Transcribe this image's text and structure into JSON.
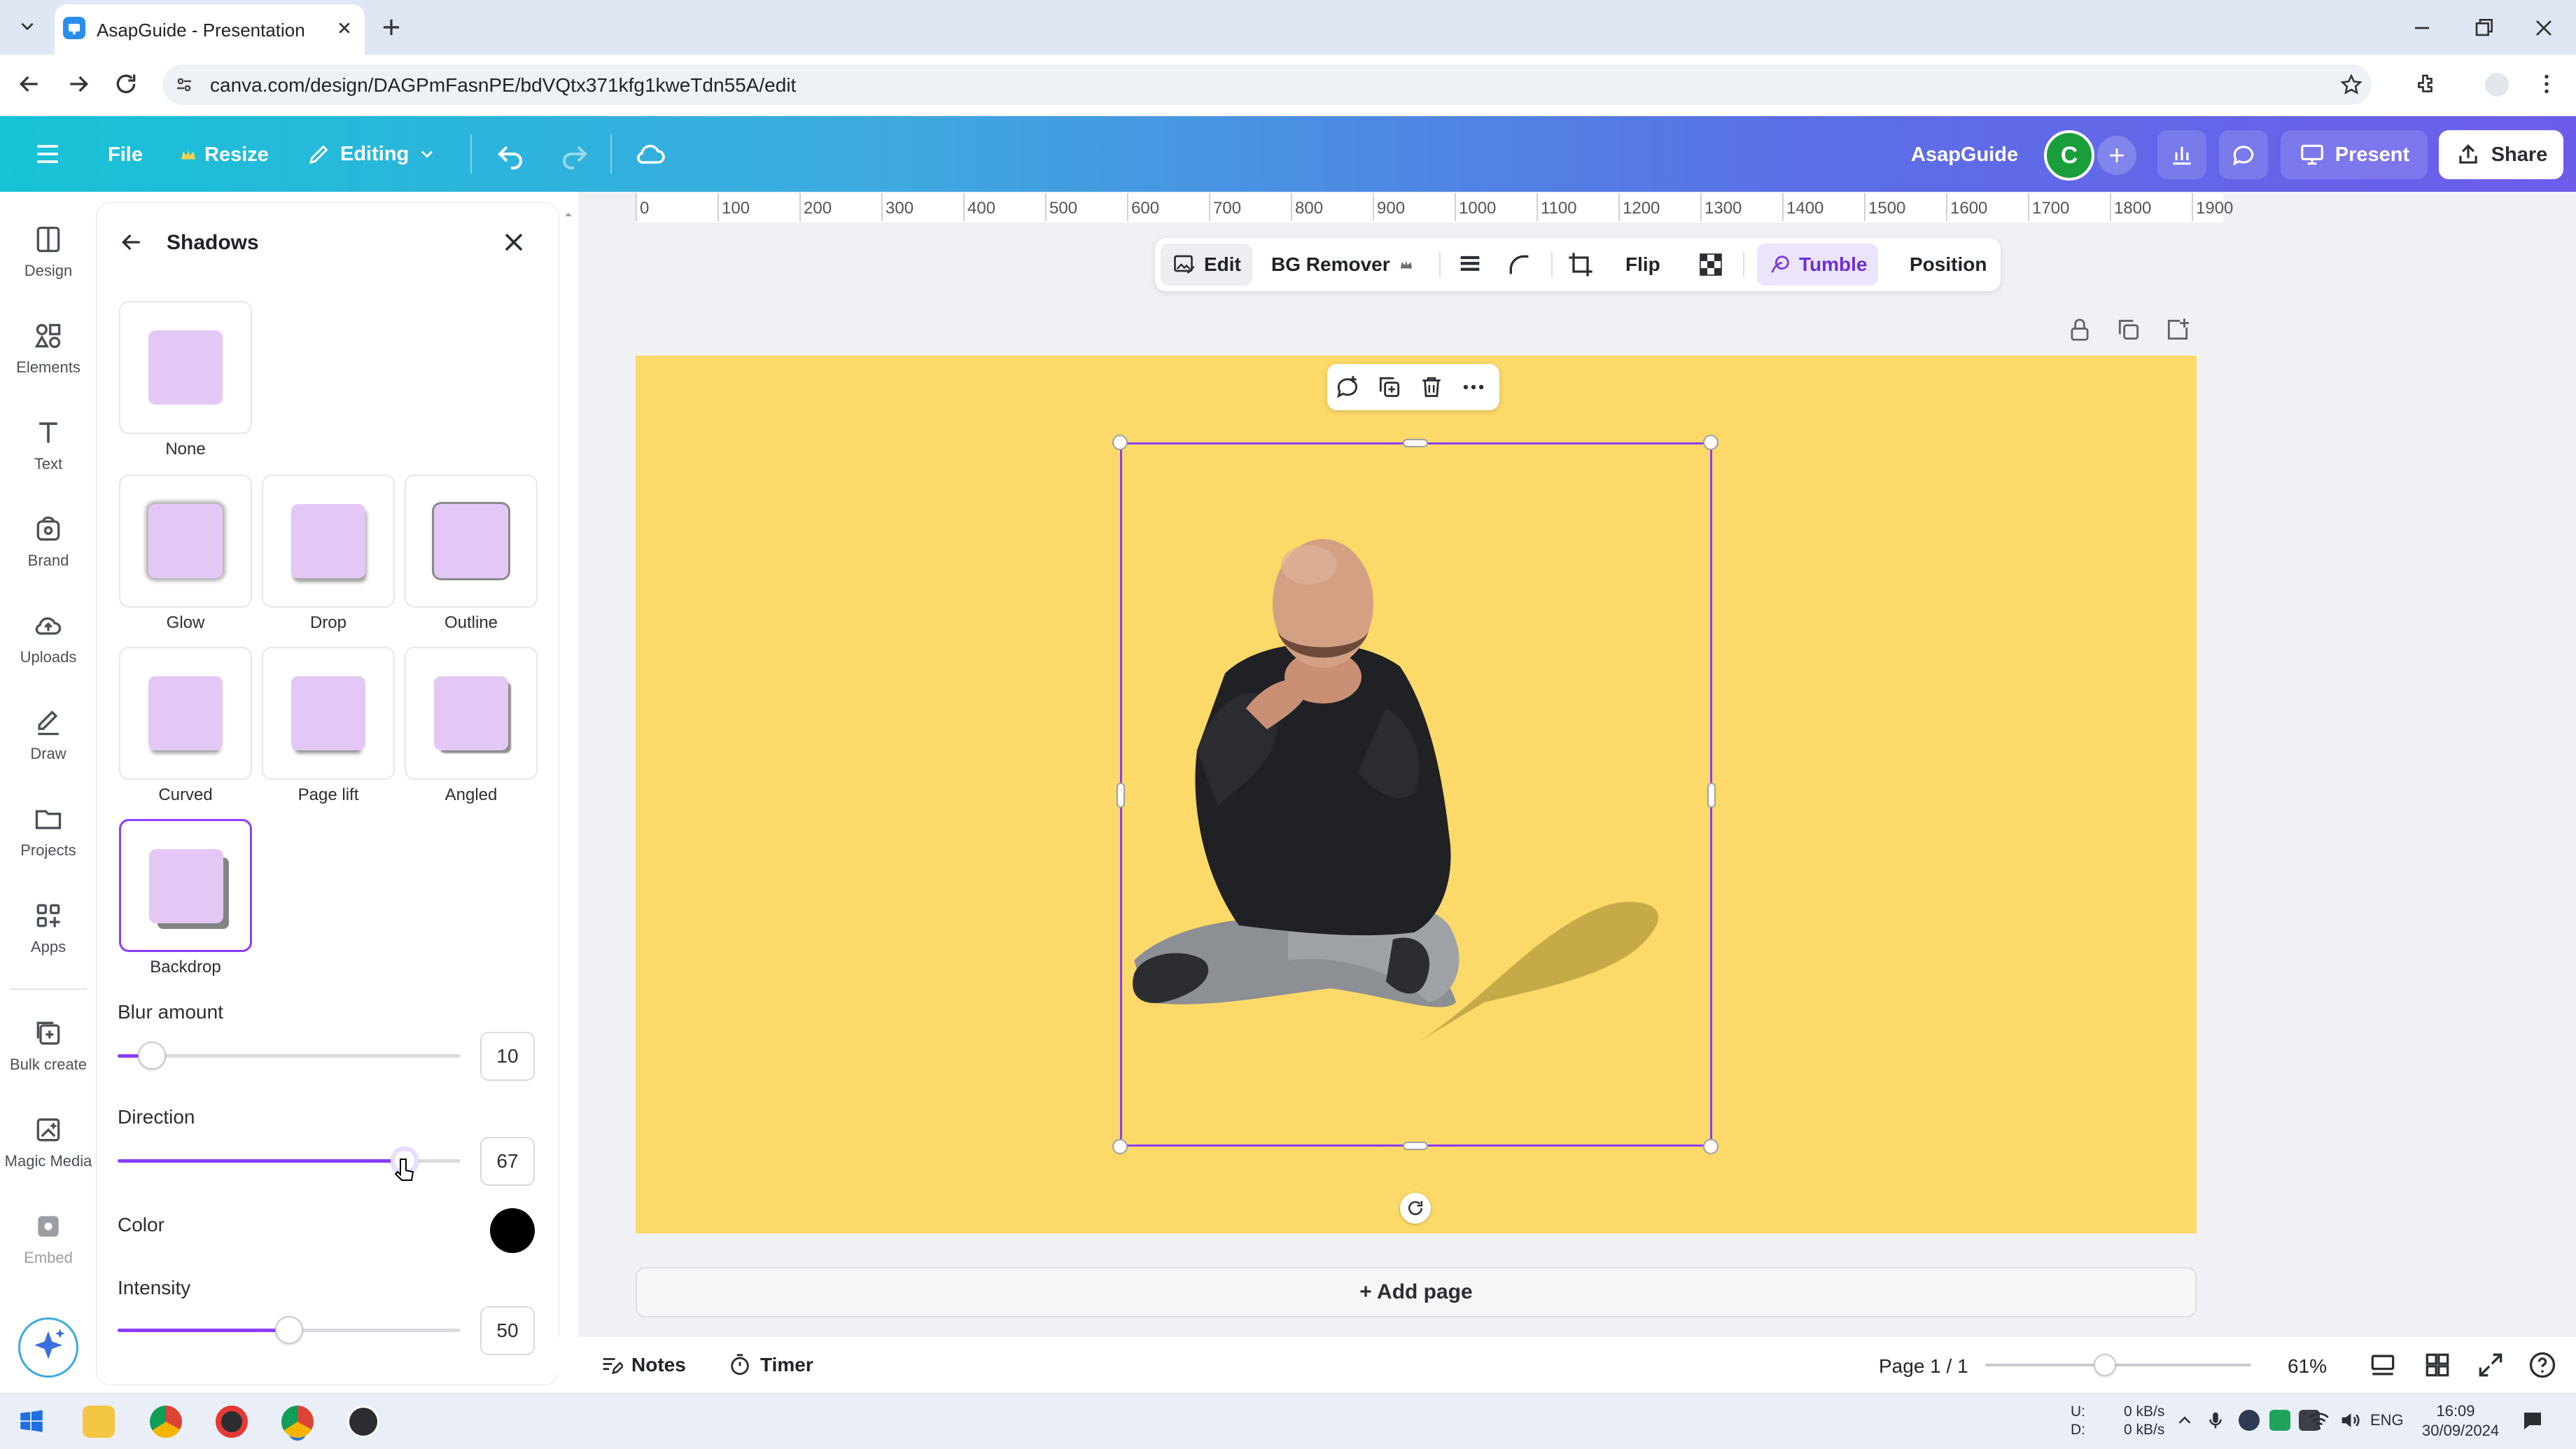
{
  "browser": {
    "tab_title": "AsapGuide - Presentation",
    "url": "canva.com/design/DAGPmFasnPE/bdVQtx371kfg1kweTdn55A/edit"
  },
  "header": {
    "file": "File",
    "resize": "Resize",
    "editing": "Editing",
    "team_name": "AsapGuide",
    "avatar_initial": "C",
    "present": "Present",
    "share": "Share"
  },
  "rail": {
    "items": [
      {
        "label": "Design"
      },
      {
        "label": "Elements"
      },
      {
        "label": "Text"
      },
      {
        "label": "Brand"
      },
      {
        "label": "Uploads"
      },
      {
        "label": "Draw"
      },
      {
        "label": "Projects"
      },
      {
        "label": "Apps"
      },
      {
        "label": "Bulk create"
      },
      {
        "label": "Magic Media"
      },
      {
        "label": "Embed"
      }
    ]
  },
  "panel": {
    "title": "Shadows",
    "options": [
      {
        "label": "None"
      },
      {
        "label": "Glow"
      },
      {
        "label": "Drop"
      },
      {
        "label": "Outline"
      },
      {
        "label": "Curved"
      },
      {
        "label": "Page lift"
      },
      {
        "label": "Angled"
      },
      {
        "label": "Backdrop"
      }
    ],
    "selected": "Backdrop",
    "blur": {
      "label": "Blur amount",
      "value": 10,
      "max": 100
    },
    "direction": {
      "label": "Direction",
      "value": 67,
      "max": 80
    },
    "color": {
      "label": "Color",
      "swatch": "#000000"
    },
    "intensity": {
      "label": "Intensity",
      "value": 50,
      "max": 100
    }
  },
  "ruler": {
    "ticks": [
      "0",
      "100",
      "200",
      "300",
      "400",
      "500",
      "600",
      "700",
      "800",
      "900",
      "1000",
      "1100",
      "1200",
      "1300",
      "1400",
      "1500",
      "1600",
      "1700",
      "1800",
      "1900"
    ]
  },
  "context_toolbar": {
    "edit": "Edit",
    "bg_remover": "BG Remover",
    "flip": "Flip",
    "tumble": "Tumble",
    "position": "Position"
  },
  "canvas": {
    "background_color": "#fcd968",
    "add_page": "+ Add page"
  },
  "bottom": {
    "notes": "Notes",
    "timer": "Timer",
    "page": "Page 1 / 1",
    "zoom": "61%",
    "zoom_fraction": 0.45
  },
  "taskbar": {
    "net_up_label": "U:",
    "net_down_label": "D:",
    "net_up": "0 kB/s",
    "net_down": "0 kB/s",
    "lang": "ENG",
    "time": "16:09",
    "date": "30/09/2024"
  },
  "colors": {
    "accent": "#8b3dff",
    "avatar": "#1a9e3b"
  }
}
